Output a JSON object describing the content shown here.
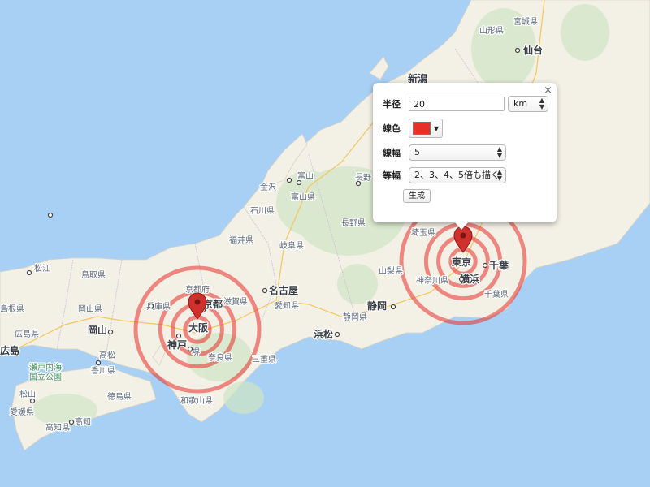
{
  "map": {
    "labels": {
      "miyagi": "宮城県",
      "yamagata": "山形県",
      "sendai": "仙台",
      "niigata": "新潟",
      "toyama_ken": "富山",
      "toyama": "富山県",
      "kanazawa": "金沢",
      "ishikawa": "石川県",
      "fukui": "福井県",
      "gifu": "岐阜県",
      "nagano_city": "長野",
      "nagano": "長野県",
      "saitama": "埼玉県",
      "tokyo": "東京",
      "chiba_city": "千葉",
      "chiba": "千葉県",
      "yokohama": "横浜",
      "kanagawa": "神奈川県",
      "yamanashi": "山梨県",
      "shizuoka": "静岡県",
      "shizuoka_city": "静岡",
      "hamamatsu": "浜松",
      "nagoya": "名古屋",
      "aichi": "愛知県",
      "mie": "三重県",
      "kyoto_fu": "京都府",
      "kyoto": "京都",
      "shiga": "滋賀県",
      "hyogo": "兵庫県",
      "osaka": "大阪",
      "kobe": "神戸",
      "sakai": "堺",
      "nara": "奈良県",
      "wakayama": "和歌山県",
      "tottori": "鳥取県",
      "matsue": "松江",
      "shimane": "島根県",
      "okayama_ken": "岡山県",
      "okayama": "岡山",
      "hiroshima_ken": "広島県",
      "hiroshima": "広島",
      "takamatsu": "高松",
      "kagawa": "香川県",
      "setonaikai_1": "瀬戸内海",
      "setonaikai_2": "国立公園",
      "matsuyama": "松山",
      "ehime": "愛媛県",
      "tokushima": "徳島県",
      "kochi_ken": "高知県",
      "kochi": "高知"
    },
    "circles": {
      "stroke_color": "#e8302a",
      "opacity": 0.55,
      "radius_km": [
        20,
        40,
        60,
        100
      ],
      "centers": [
        "大阪",
        "東京"
      ]
    }
  },
  "panel": {
    "radius_label": "半径",
    "radius_value": "20",
    "unit_value": "km",
    "line_color_label": "線色",
    "line_color": "#e8302a",
    "line_width_label": "線幅",
    "line_width_value": "5",
    "equal_width_label": "等幅",
    "equal_width_value": "2、3、4、5倍も描く",
    "generate_label": "生成",
    "close_symbol": "×"
  }
}
